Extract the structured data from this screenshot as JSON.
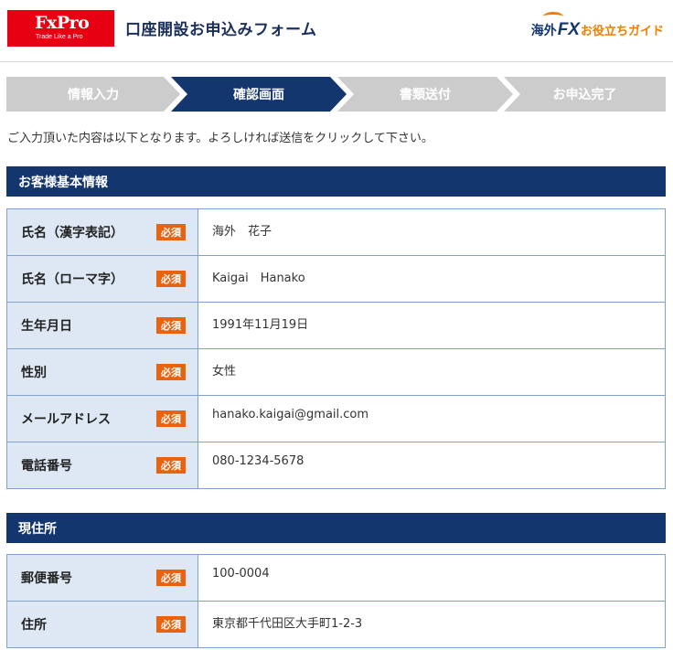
{
  "header": {
    "logo_text": "FxPro",
    "logo_tagline": "Trade Like a Pro",
    "title": "口座開設お申込みフォーム",
    "guide_part1": "海外",
    "guide_part2": "FX",
    "guide_part3": "お役立ちガイド"
  },
  "steps": [
    {
      "label": "情報入力",
      "active": false
    },
    {
      "label": "確認画面",
      "active": true
    },
    {
      "label": "書類送付",
      "active": false
    },
    {
      "label": "お申込完了",
      "active": false
    }
  ],
  "intro": "ご入力頂いた内容は以下となります。よろしければ送信をクリックして下さい。",
  "required_badge": "必須",
  "sections": [
    {
      "title": "お客様基本情報",
      "rows": [
        {
          "label": "氏名（漢字表記）",
          "value": "海外　花子"
        },
        {
          "label": "氏名（ローマ字）",
          "value": "Kaigai　Hanako"
        },
        {
          "label": "生年月日",
          "value": "1991年11月19日"
        },
        {
          "label": "性別",
          "value": "女性"
        },
        {
          "label": "メールアドレス",
          "value": "hanako.kaigai@gmail.com"
        },
        {
          "label": "電話番号",
          "value": "080-1234-5678"
        }
      ]
    },
    {
      "title": "現住所",
      "rows": [
        {
          "label": "郵便番号",
          "value": "100-0004"
        },
        {
          "label": "住所",
          "value": "東京都千代田区大手町1-2-3"
        }
      ]
    }
  ],
  "colors": {
    "navy": "#14366e",
    "step_inactive": "#cccccc",
    "label_bg": "#dde8f4",
    "required_orange": "#e8620f",
    "brand_red": "#e60012"
  }
}
